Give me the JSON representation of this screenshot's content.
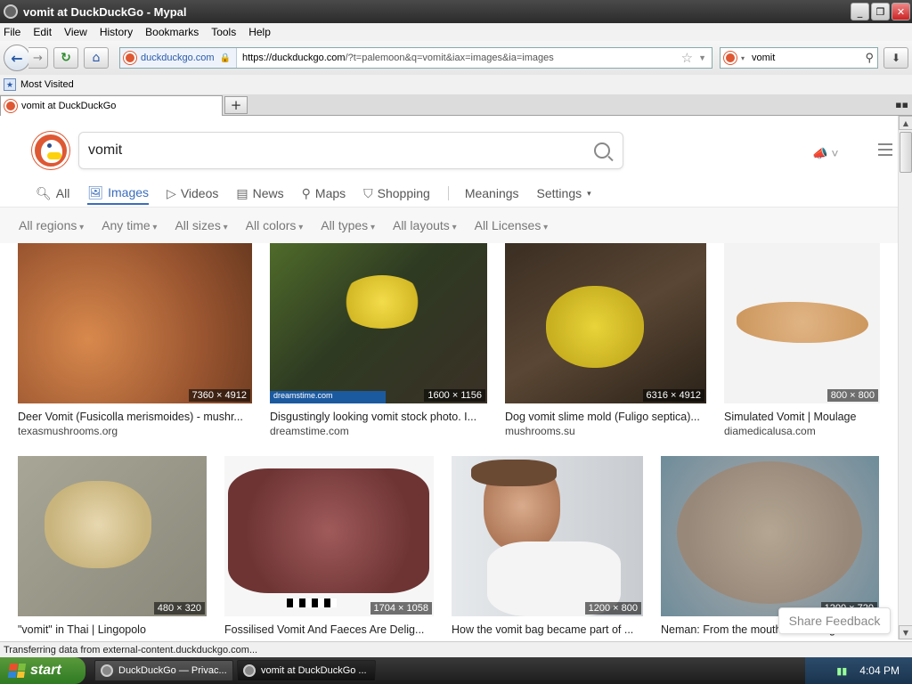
{
  "window": {
    "title": "vomit at DuckDuckGo - Mypal"
  },
  "menu": [
    "File",
    "Edit",
    "View",
    "History",
    "Bookmarks",
    "Tools",
    "Help"
  ],
  "nav": {
    "identity_host": "duckduckgo.com",
    "url_host": "https://duckduckgo.com",
    "url_rest": "/?t=palemoon&q=vomit&iax=images&ia=images",
    "search_value": "vomit"
  },
  "bookmarks": {
    "most_visited": "Most Visited"
  },
  "tab": {
    "label": "vomit at DuckDuckGo"
  },
  "ddg": {
    "query": "vomit",
    "tabs": [
      {
        "label": "All",
        "icon": "search-icon"
      },
      {
        "label": "Images",
        "icon": "image-icon"
      },
      {
        "label": "Videos",
        "icon": "play-icon"
      },
      {
        "label": "News",
        "icon": "news-icon"
      },
      {
        "label": "Maps",
        "icon": "map-pin-icon"
      },
      {
        "label": "Shopping",
        "icon": "bag-icon"
      },
      {
        "label": "Meanings"
      },
      {
        "label": "Settings"
      }
    ],
    "filters": [
      "All regions",
      "Any time",
      "All sizes",
      "All colors",
      "All types",
      "All layouts",
      "All Licenses"
    ],
    "results": [
      {
        "caption": "Deer Vomit (Fusicolla merismoides) - mushr...",
        "source": "texasmushrooms.org",
        "dims": "7360 × 4912",
        "bg": "#b86a3a"
      },
      {
        "caption": "Disgustingly looking vomit stock photo. I...",
        "source": "dreamstime.com",
        "dims": "1600 × 1156",
        "bg": "#3e4a2a",
        "watermark": "dreamstime.com"
      },
      {
        "caption": "Dog vomit slime mold (Fuligo septica)...",
        "source": "mushrooms.su",
        "dims": "6316 × 4912",
        "bg": "#4a3a28"
      },
      {
        "caption": "Simulated Vomit | Moulage",
        "source": "diamedicalusa.com",
        "dims": "800 × 800",
        "bg": "#f2f2f2"
      },
      {
        "caption": "\"vomit\" in Thai | Lingopolo",
        "source": "",
        "dims": "480 × 320",
        "bg": "#9a9888"
      },
      {
        "caption": "Fossilised Vomit And Faeces Are Delig...",
        "source": "",
        "dims": "1704 × 1058",
        "bg": "#f4f4f4"
      },
      {
        "caption": "How the vomit bag became part of ...",
        "source": "",
        "dims": "1200 × 800",
        "bg": "#d9dde2"
      },
      {
        "caption": "Neman: From the mouths of sixth-grader...",
        "source": "",
        "dims": "1200 × 720",
        "bg": "#7a9aa8"
      }
    ],
    "share_feedback": "Share Feedback"
  },
  "status": "Transferring data from external-content.duckduckgo.com...",
  "taskbar": {
    "start": "start",
    "items": [
      "DuckDuckGo — Privac...",
      "vomit at DuckDuckGo ..."
    ],
    "clock": "4:04 PM"
  }
}
